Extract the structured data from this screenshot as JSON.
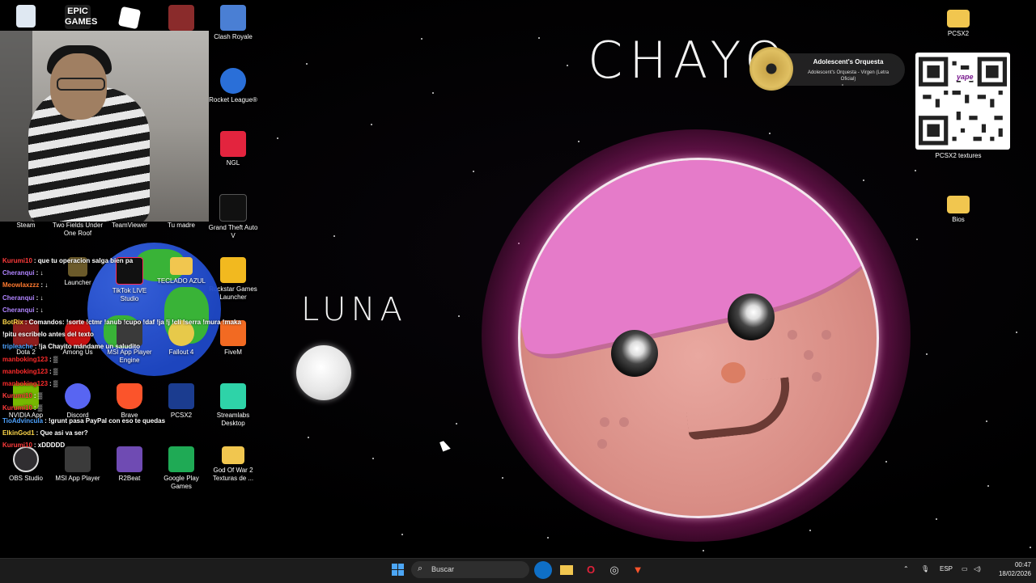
{
  "desktop": {
    "icons": {
      "recycle_bin": "",
      "epic_games": "EPIC GAMES",
      "roblox": "",
      "game_app": "",
      "clash_royale": "Clash Royale",
      "rocket_league": "Rocket League®",
      "ngl": "NGL",
      "gta": "Grand Theft Auto V",
      "rockstar": "Rockstar Games Launcher",
      "fivem": "FiveM",
      "streamlabs": "Streamlabs Desktop",
      "god_of_war": "God Of War 2 Texturas de ...",
      "obs": "OBS Studio",
      "msi_player": "MSI App Player",
      "r2beat": "R2Beat",
      "google_play": "Google Play Games",
      "discord": "Discord",
      "brave": "Brave",
      "pcsx2_app": "PCSX2",
      "tiktok_live": "TikTok LIVE Studio",
      "teclado_azul": "TECLADO AZUL",
      "fallout4": "Fallout 4",
      "msi_engine": "MSI App Player Engine",
      "among_us": "Among Us",
      "dota2": "Dota 2",
      "launcher": "Launcher",
      "nvidia": "NVIDIA App",
      "steam": "Steam",
      "two_fields": "Two Fields Under One Roof",
      "teamviewer": "TeamViewer",
      "tu_madre": "Tu madre",
      "pcsx2_folder": "PCSX2",
      "pcsx2_textures": "PCSX2 textures",
      "bios": "Bios"
    },
    "drawing": {
      "name_text": "CHAYO",
      "moon_text": "LUNA"
    },
    "qr_brand": "yape",
    "media": {
      "title": "Adolescent's Orquesta",
      "subtitle": "Adolescent's Orquesta - Virgen (Letra Oficial)"
    }
  },
  "chat": [
    {
      "user": "Kurumi10",
      "msg": ": que tu operacion salga bien pa",
      "color": "#ff3b3b"
    },
    {
      "user": "Cheranqui",
      "msg": ": ↓",
      "color": "#b084ff"
    },
    {
      "user": "Meowlaxzzz",
      "msg": ": ↓",
      "color": "#ff7a2f"
    },
    {
      "user": "Cheranqui",
      "msg": ": ↓",
      "color": "#b084ff"
    },
    {
      "user": "Cheranqui",
      "msg": ": ↓",
      "color": "#b084ff"
    },
    {
      "user": "BotRix",
      "msg": ": Comandos: !sorte !ctmr !anub !cupo !daf !ja !j !cli !serra !mura !maka",
      "color": "#ffd84a"
    },
    {
      "user": "",
      "msg": "!pitu escribelo antes del texto",
      "color": "#ffffff"
    },
    {
      "user": "tripleache",
      "msg": ": !ja Chayito mándame un saludito",
      "color": "#4ea3ff"
    },
    {
      "user": "manboking123",
      "msg": ": ▒",
      "color": "#ff2b2b"
    },
    {
      "user": "manboking123",
      "msg": ": ▒",
      "color": "#ff2b2b"
    },
    {
      "user": "manboking123",
      "msg": ": ▒",
      "color": "#ff2b2b"
    },
    {
      "user": "Kurumi10",
      "msg": ": ▒",
      "color": "#ff3b3b"
    },
    {
      "user": "Kurumi10",
      "msg": ": ▒",
      "color": "#ff3b3b"
    },
    {
      "user": "TioAdvincula",
      "msg": ": !grunt pasa PayPal con eso te quedas",
      "color": "#4ea3ff"
    },
    {
      "user": "ElkinGod1",
      "msg": ": Que asi va ser?",
      "color": "#ffd84a"
    },
    {
      "user": "Kurumi10",
      "msg": ": xDDDDD",
      "color": "#ff3b3b"
    }
  ],
  "taskbar": {
    "search_placeholder": "Buscar",
    "language": "ESP",
    "time": "00:47",
    "date": "18/02/2026"
  }
}
